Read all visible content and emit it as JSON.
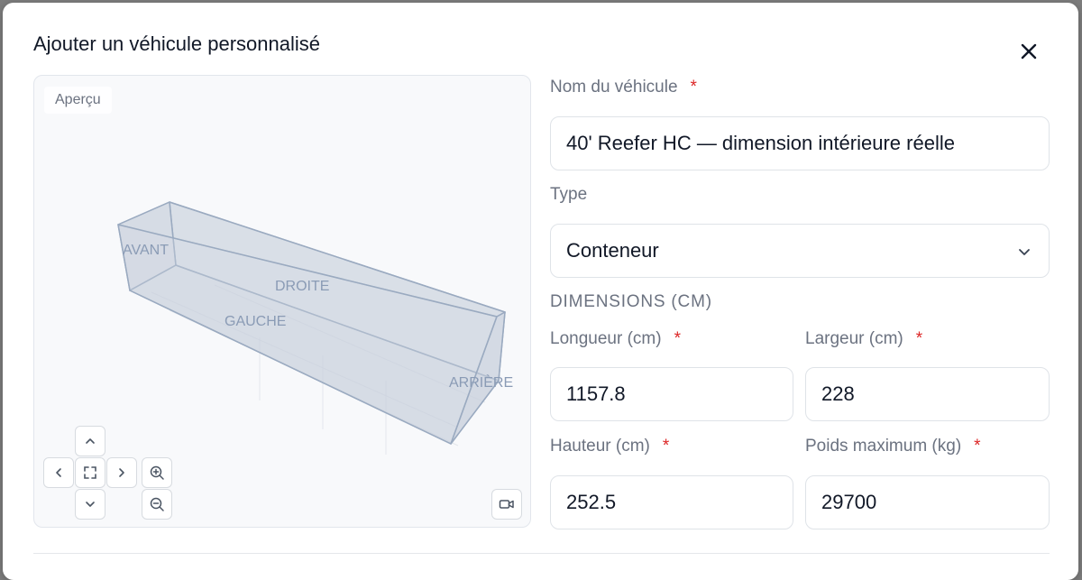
{
  "dialog": {
    "title": "Ajouter un véhicule personnalisé"
  },
  "preview": {
    "label": "Aperçu",
    "face_labels": {
      "front": "AVANT",
      "right": "DROITE",
      "left": "GAUCHE",
      "rear": "ARRIÈRE"
    },
    "controls": [
      "up-arrow",
      "left-arrow",
      "fit-view",
      "right-arrow",
      "down-arrow",
      "zoom-in",
      "zoom-out",
      "camera"
    ]
  },
  "form": {
    "vehicle_name": {
      "label": "Nom du véhicule",
      "required_mark": "*",
      "value": "40' Reefer HC — dimension intérieure réelle"
    },
    "type": {
      "label": "Type",
      "value": "Conteneur"
    },
    "dimensions_heading": "DIMENSIONS (CM)",
    "length": {
      "label": "Longueur (cm)",
      "required_mark": "*",
      "value": "1157.8"
    },
    "width": {
      "label": "Largeur (cm)",
      "required_mark": "*",
      "value": "228"
    },
    "height": {
      "label": "Hauteur (cm)",
      "required_mark": "*",
      "value": "252.5"
    },
    "max_weight": {
      "label": "Poids maximum (kg)",
      "required_mark": "*",
      "value": "29700"
    }
  },
  "colors": {
    "required": "#dc2626",
    "box_fill": "#c8d0dc",
    "box_edge": "#9aaac0",
    "face_label": "#8a9bb5"
  }
}
